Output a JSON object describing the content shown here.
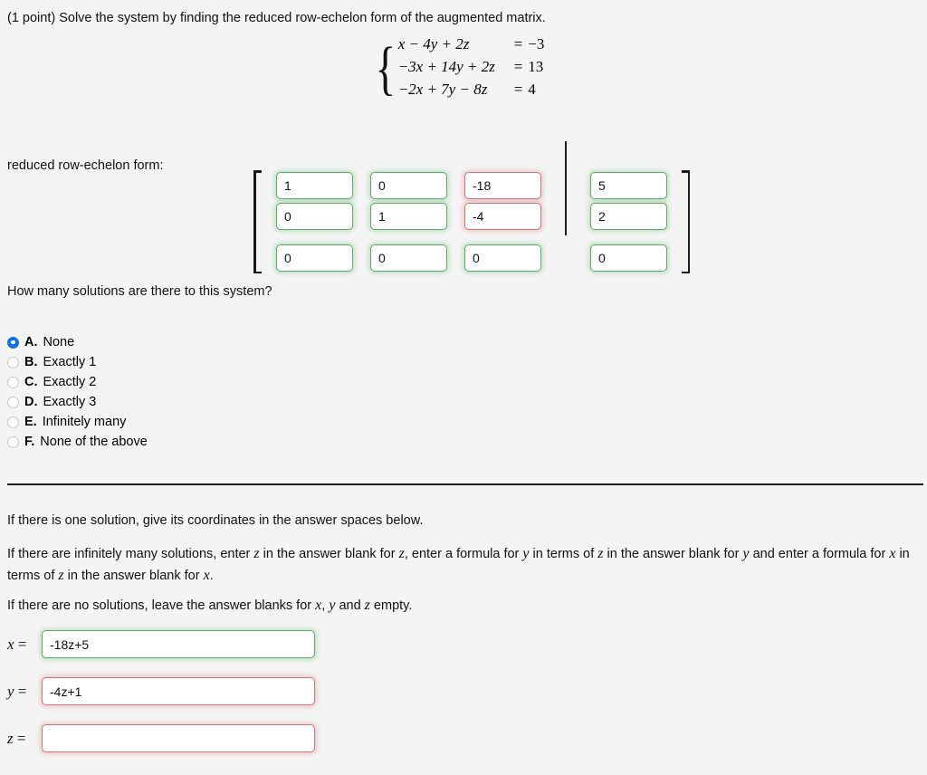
{
  "problem": {
    "heading": "(1 point) Solve the system by finding the reduced row-echelon form of the augmented matrix.",
    "system": {
      "brace": "{",
      "equations": [
        {
          "lhs": "x − 4y + 2z",
          "eq": "=",
          "rhs": "−3"
        },
        {
          "lhs": "−3x + 14y + 2z",
          "eq": "=",
          "rhs": "13"
        },
        {
          "lhs": "−2x + 7y − 8z",
          "eq": "=",
          "rhs": "4"
        }
      ]
    }
  },
  "rref": {
    "label": "reduced row-echelon form:",
    "left_bracket": "[",
    "right_bracket": "]",
    "rows": [
      [
        {
          "value": "1",
          "state": "ok"
        },
        {
          "value": "0",
          "state": "ok"
        },
        {
          "value": "-18",
          "state": "bad"
        },
        {
          "value": "5",
          "state": "ok"
        }
      ],
      [
        {
          "value": "0",
          "state": "ok"
        },
        {
          "value": "1",
          "state": "ok"
        },
        {
          "value": "-4",
          "state": "bad"
        },
        {
          "value": "2",
          "state": "ok"
        }
      ],
      [
        {
          "value": "0",
          "state": "ok"
        },
        {
          "value": "0",
          "state": "ok"
        },
        {
          "value": "0",
          "state": "ok"
        },
        {
          "value": "0",
          "state": "ok"
        }
      ]
    ]
  },
  "question": {
    "text": "How many solutions are there to this system?",
    "options": [
      {
        "letter": "A.",
        "label": "None",
        "selected": true
      },
      {
        "letter": "B.",
        "label": "Exactly 1",
        "selected": false
      },
      {
        "letter": "C.",
        "label": "Exactly 2",
        "selected": false
      },
      {
        "letter": "D.",
        "label": "Exactly 3",
        "selected": false
      },
      {
        "letter": "E.",
        "label": "Infinitely many",
        "selected": false
      },
      {
        "letter": "F.",
        "label": "None of the above",
        "selected": false
      }
    ]
  },
  "instructions": {
    "p1": "If there is one solution, give its coordinates in the answer spaces below.",
    "p2_part1": "If there are infinitely many solutions, enter ",
    "p2_v1": "z",
    "p2_part2": " in the answer blank for ",
    "p2_v2": "z",
    "p2_part3": ", enter a formula for ",
    "p2_v3": "y",
    "p2_part4": " in terms of ",
    "p2_v4": "z",
    "p2_part5": " in the answer blank for ",
    "p2_v5": "y",
    "p2_part6": " and enter a formula for ",
    "p2_v6": "x",
    "p2_part7": " in terms of ",
    "p2_v7": "z",
    "p2_part8": " in the answer blank for ",
    "p2_v8": "x",
    "p2_part9": ".",
    "p3_part1": "If there are no solutions, leave the answer blanks for ",
    "p3_v1": "x",
    "p3_part2": ", ",
    "p3_v2": "y",
    "p3_part3": " and ",
    "p3_v3": "z",
    "p3_part4": " empty."
  },
  "answers": [
    {
      "variable": "x",
      "equals": "=",
      "value": "-18z+5",
      "state": "ok"
    },
    {
      "variable": "y",
      "equals": "=",
      "value": "-4z+1",
      "state": "bad"
    },
    {
      "variable": "z",
      "equals": "=",
      "value": "",
      "state": "bad"
    }
  ],
  "colors": {
    "background": "#f4f4f4",
    "correct_border": "#5ba96b",
    "incorrect_border": "#cb767c",
    "radio_selected": "#0b72e8",
    "text": "#111111"
  }
}
